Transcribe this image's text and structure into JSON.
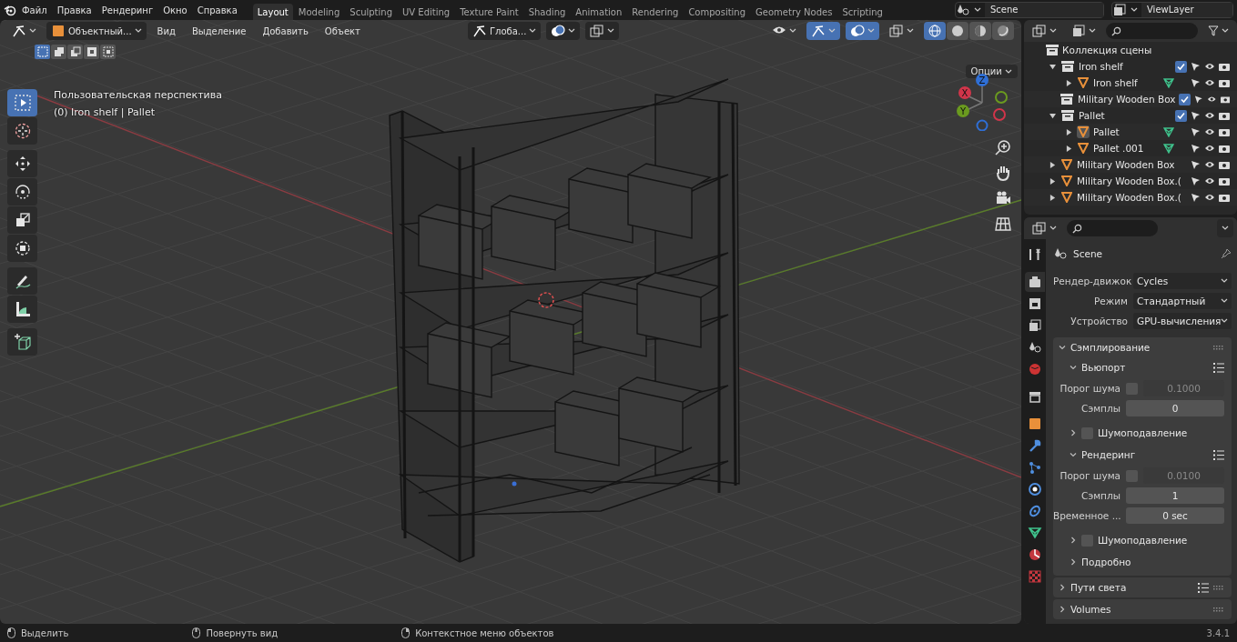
{
  "menu": [
    "Файл",
    "Правка",
    "Рендеринг",
    "Окно",
    "Справка"
  ],
  "workspaces": [
    {
      "label": "Layout",
      "selected": true
    },
    {
      "label": "Modeling",
      "selected": false
    },
    {
      "label": "Sculpting",
      "selected": false
    },
    {
      "label": "UV Editing",
      "selected": false
    },
    {
      "label": "Texture Paint",
      "selected": false
    },
    {
      "label": "Shading",
      "selected": false
    },
    {
      "label": "Animation",
      "selected": false
    },
    {
      "label": "Rendering",
      "selected": false
    },
    {
      "label": "Compositing",
      "selected": false
    },
    {
      "label": "Geometry Nodes",
      "selected": false
    },
    {
      "label": "Scripting",
      "selected": false
    }
  ],
  "scene": "Scene",
  "view_layer": "ViewLayer",
  "viewport": {
    "mode": "Объектный...",
    "menus": [
      "Вид",
      "Выделение",
      "Добавить",
      "Объект"
    ],
    "orientation": "Глоба...",
    "options": "Опции",
    "select_modes": [
      {
        "kind": "set",
        "selected": true
      },
      {
        "kind": "extend",
        "selected": false
      },
      {
        "kind": "subtract",
        "selected": false
      },
      {
        "kind": "invert",
        "selected": false
      },
      {
        "kind": "intersect",
        "selected": false
      }
    ],
    "toggles": [
      {
        "kind": "visibility",
        "on": false
      },
      {
        "kind": "gizmo",
        "on": true
      },
      {
        "kind": "overlay",
        "on": true
      },
      {
        "kind": "xray",
        "on": false
      }
    ],
    "shading": [
      {
        "kind": "wireframe",
        "selected": true
      },
      {
        "kind": "solid",
        "selected": false
      },
      {
        "kind": "material",
        "selected": false
      },
      {
        "kind": "rendered",
        "selected": false
      }
    ],
    "info": [
      "Пользовательская перспектива",
      "(0) Iron shelf | Pallet"
    ],
    "tool_groups": [
      [
        {
          "kind": "select",
          "selected": true
        },
        {
          "kind": "cursor",
          "selected": false
        }
      ],
      [
        {
          "kind": "move",
          "selected": false
        },
        {
          "kind": "rotate",
          "selected": false
        },
        {
          "kind": "scale",
          "selected": false
        },
        {
          "kind": "transform",
          "selected": false
        }
      ],
      [
        {
          "kind": "annotate",
          "selected": false
        },
        {
          "kind": "measure",
          "selected": false
        }
      ],
      [
        {
          "kind": "add-cube",
          "selected": false
        }
      ]
    ],
    "axes": [
      {
        "label": "Z",
        "color": "#2f6fd6"
      },
      {
        "label": "X",
        "color": "#d1354a"
      },
      {
        "label": "Y",
        "color": "#6a9a1f"
      }
    ]
  },
  "outliner": {
    "root": "Коллекция сцены",
    "items": [
      {
        "kind": "collection",
        "name": "Iron shelf",
        "expanded": true,
        "checked": true,
        "active": false,
        "children": [
          {
            "kind": "object",
            "name": "Iron shelf",
            "expanded": false,
            "active": false,
            "mesh": true
          }
        ]
      },
      {
        "kind": "collection",
        "name": "Military Wooden Box",
        "checked": true,
        "active": false
      },
      {
        "kind": "collection",
        "name": "Pallet",
        "expanded": true,
        "checked": true,
        "active": false,
        "children": [
          {
            "kind": "object",
            "name": "Pallet",
            "expanded": false,
            "active": true,
            "mesh": true
          },
          {
            "kind": "object",
            "name": "Pallet .001",
            "expanded": false,
            "active": false,
            "mesh": true
          }
        ]
      },
      {
        "kind": "object",
        "name": "Military Wooden Box",
        "expanded": false,
        "active": false
      },
      {
        "kind": "object",
        "name": "Military Wooden Box.(",
        "expanded": false,
        "active": false
      },
      {
        "kind": "object",
        "name": "Military Wooden Box.(",
        "expanded": false,
        "active": false
      }
    ]
  },
  "properties": {
    "tabs": [
      {
        "kind": "tool",
        "selected": false
      },
      {
        "kind": "render",
        "selected": true
      },
      {
        "kind": "output",
        "selected": false
      },
      {
        "kind": "view-layer",
        "selected": false
      },
      {
        "kind": "scene",
        "selected": false
      },
      {
        "kind": "world",
        "selected": false
      },
      {
        "kind": "collection",
        "selected": false
      },
      {
        "kind": "object",
        "selected": false
      },
      {
        "kind": "modifiers",
        "selected": false
      },
      {
        "kind": "particles",
        "selected": false
      },
      {
        "kind": "physics",
        "selected": false
      },
      {
        "kind": "constraints",
        "selected": false
      },
      {
        "kind": "data",
        "selected": false
      },
      {
        "kind": "material",
        "selected": false
      },
      {
        "kind": "texture",
        "selected": false
      }
    ],
    "context": "Scene",
    "fields": [
      {
        "label": "Рендер-движок",
        "value": "Cycles"
      },
      {
        "label": "Режим",
        "value": "Стандартный"
      },
      {
        "label": "Устройство",
        "value": "GPU-вычисления"
      }
    ],
    "panels": [
      {
        "title": "Сэмплирование",
        "expanded": true,
        "children": [
          {
            "title": "Вьюпорт",
            "expanded": true,
            "presets": true,
            "rows": [
              {
                "kind": "toggle-number",
                "label": "Порог шума",
                "checked": false,
                "value": "0.1000"
              },
              {
                "kind": "number",
                "label": "Сэмплы",
                "value": "0"
              }
            ]
          },
          {
            "title": "Шумоподавление",
            "expanded": false,
            "checked": false
          },
          {
            "title": "Рендеринг",
            "expanded": true,
            "presets": true,
            "rows": [
              {
                "kind": "toggle-number",
                "label": "Порог шума",
                "checked": false,
                "value": "0.0100"
              },
              {
                "kind": "number",
                "label": "Сэмплы",
                "value": "1"
              },
              {
                "kind": "number",
                "label": "Временное ...",
                "value": "0 sec"
              }
            ]
          },
          {
            "title": "Шумоподавление",
            "expanded": false,
            "checked": false
          },
          {
            "title": "Подробно",
            "expanded": false
          }
        ]
      },
      {
        "title": "Пути света",
        "expanded": false,
        "presets": true
      },
      {
        "title": "Volumes",
        "expanded": false
      }
    ]
  },
  "status": [
    {
      "kind": "mouse-left",
      "label": "Выделить"
    },
    {
      "kind": "mouse-middle",
      "label": "Повернуть вид"
    },
    {
      "kind": "mouse-right",
      "label": "Контекстное меню объектов"
    }
  ],
  "version": "3.4.1"
}
